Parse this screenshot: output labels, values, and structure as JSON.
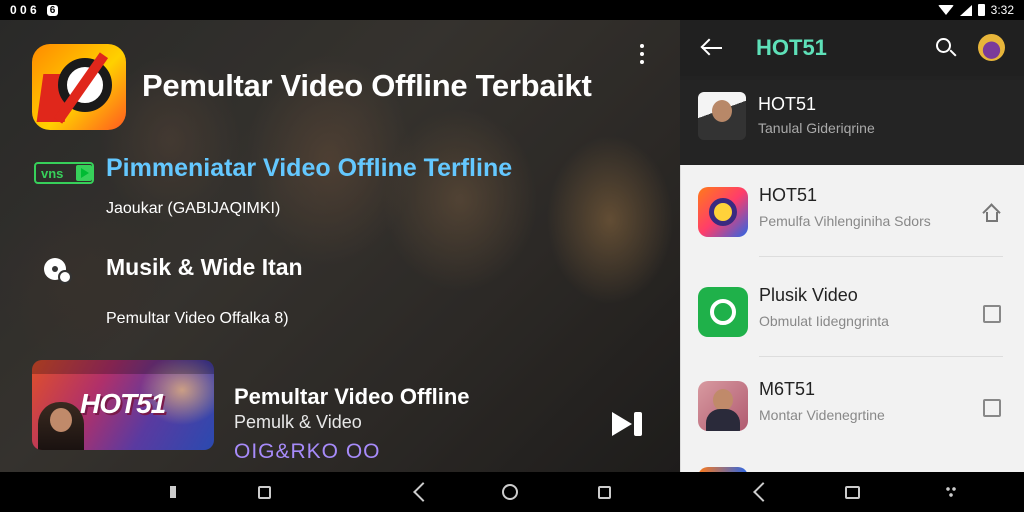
{
  "status_bar": {
    "left_text": "0 0 6",
    "left_chip": "6",
    "time": "3:32"
  },
  "left_pane": {
    "main_title": "Pemultar Video Offline Terbaikt",
    "badge": "vns",
    "subtitle": "Pimmeniatar Video Offline Terfline",
    "tagline": "Jaoukar (GABIJAQIMKI)",
    "section_title": "Musik & Wide Itan",
    "section_sub": "Pemultar Video Offalka 8)",
    "now_playing": {
      "thumbnail_label": "HOT51",
      "title": "Pemultar Video Offline",
      "subtitle": "Pemulk & Video",
      "code": "OIG&RKO OO"
    }
  },
  "right_pane": {
    "title": "HOT51",
    "dark_item": {
      "title": "HOT51",
      "subtitle": "Tanulal Gideriqrine"
    },
    "items": [
      {
        "title": "HOT51",
        "subtitle": "Pemulfa Vihlenginiha Sdors",
        "trailing": "home-icon"
      },
      {
        "title": "Plusik Video",
        "subtitle": "Obmulat Iidegngrinta",
        "trailing": "checkbox"
      },
      {
        "title": "M6T51",
        "subtitle": "Montar Videnegrtine",
        "trailing": "checkbox"
      }
    ]
  },
  "colors": {
    "accent_cyan": "#64c8ff",
    "accent_green": "#37d05a",
    "accent_teal": "#5ee0b8",
    "accent_purple": "#a78bfa"
  }
}
